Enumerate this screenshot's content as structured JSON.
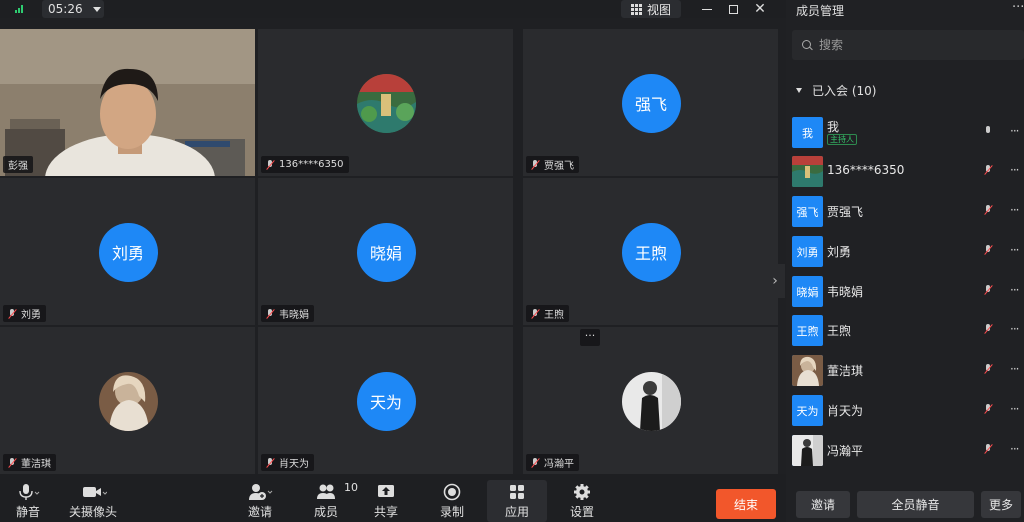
{
  "topbar": {
    "timer": "05:26",
    "view_label": "视图"
  },
  "tiles": [
    {
      "name": "彭强",
      "kind": "video",
      "muted": false
    },
    {
      "name": "136****6350",
      "avatar": "",
      "kind": "photo",
      "muted": true
    },
    {
      "name": "贾强飞",
      "avatar": "强飞",
      "kind": "text",
      "muted": true
    },
    {
      "name": "刘勇",
      "avatar": "刘勇",
      "kind": "text",
      "muted": true
    },
    {
      "name": "韦晓娟",
      "avatar": "晓娟",
      "kind": "text",
      "muted": true
    },
    {
      "name": "王煦",
      "avatar": "王煦",
      "kind": "text",
      "muted": true
    },
    {
      "name": "董洁琪",
      "avatar": "",
      "kind": "photo",
      "muted": true
    },
    {
      "name": "肖天为",
      "avatar": "天为",
      "kind": "text",
      "muted": true
    },
    {
      "name": "冯瀚平",
      "avatar": "",
      "kind": "photo",
      "muted": true
    }
  ],
  "tile_more": "···",
  "toolbar": {
    "mute": "静音",
    "camera": "关摄像头",
    "invite": "邀请",
    "members": "成员",
    "members_count": "10",
    "share": "共享",
    "record": "录制",
    "apps": "应用",
    "settings": "设置",
    "end": "结束"
  },
  "panel": {
    "title": "成员管理",
    "more": "···",
    "search_placeholder": "搜索",
    "joined": "已入会 (10)",
    "members": [
      {
        "avatar": "我",
        "name": "我",
        "host_badge": "主持人",
        "muted": false
      },
      {
        "avatar": "",
        "name": "136****6350",
        "muted": true
      },
      {
        "avatar": "强飞",
        "name": "贾强飞",
        "muted": true
      },
      {
        "avatar": "刘勇",
        "name": "刘勇",
        "muted": true
      },
      {
        "avatar": "晓娟",
        "name": "韦晓娟",
        "muted": true
      },
      {
        "avatar": "王煦",
        "name": "王煦",
        "muted": true
      },
      {
        "avatar": "",
        "name": "董洁琪",
        "muted": true
      },
      {
        "avatar": "天为",
        "name": "肖天为",
        "muted": true
      },
      {
        "avatar": "",
        "name": "冯瀚平",
        "muted": true
      }
    ],
    "invite": "邀请",
    "mute_all": "全员静音",
    "more_btn": "更多",
    "item_more": "···"
  },
  "colors": {
    "accent": "#1e88f6",
    "end": "#f2572b",
    "host": "#36c46b",
    "muted": "#ff4d4f"
  }
}
